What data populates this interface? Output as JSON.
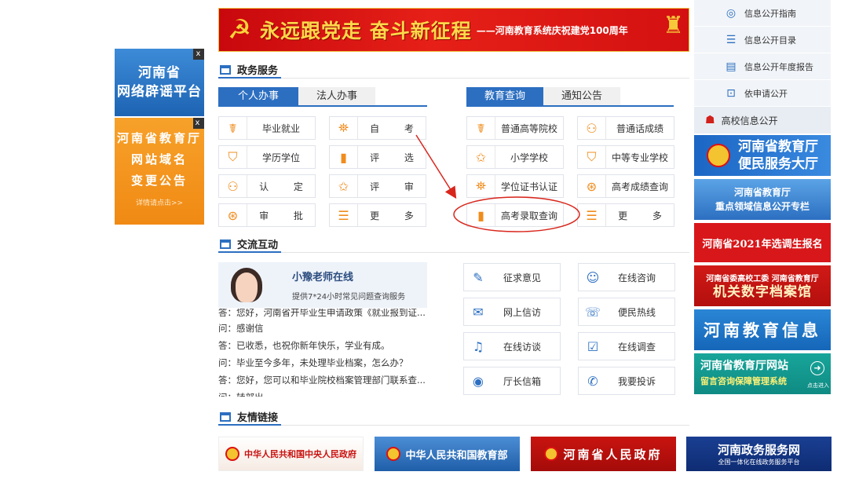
{
  "ads": {
    "rumor": {
      "line1": "河南省",
      "line2": "网络辟谣平台",
      "close": "x"
    },
    "domain": {
      "line1": "河南省教育厅",
      "line2": "网站域名",
      "line3": "变更公告",
      "more": "详情请点击>>",
      "close": "x"
    }
  },
  "banner": {
    "slogan": "永远跟党走 奋斗新征程",
    "sub": "——河南教育系统庆祝建党100周年"
  },
  "gov_service": {
    "title": "政务服务",
    "tabs_left": [
      "个人办事",
      "法人办事"
    ],
    "tabs_right": [
      "教育查询",
      "通知公告"
    ],
    "personal": [
      {
        "label": "毕业就业",
        "icon": "medal-icon",
        "glyph": "☤"
      },
      {
        "label": "自 考",
        "icon": "gift-icon",
        "glyph": "⛯"
      },
      {
        "label": "学历学位",
        "icon": "mortarboard-icon",
        "glyph": "⛉"
      },
      {
        "label": "评 选",
        "icon": "bar-chart-icon",
        "glyph": "▮"
      },
      {
        "label": "认 定",
        "icon": "user-icon",
        "glyph": "⚇"
      },
      {
        "label": "评 审",
        "icon": "star-icon",
        "glyph": "✩"
      },
      {
        "label": "审 批",
        "icon": "seal-icon",
        "glyph": "⊛"
      },
      {
        "label": "更 多",
        "icon": "list-icon",
        "glyph": "☰"
      }
    ],
    "query": [
      {
        "label": "普通高等院校",
        "icon": "medal-icon",
        "glyph": "☤"
      },
      {
        "label": "普通话成绩",
        "icon": "user-icon",
        "glyph": "⚇"
      },
      {
        "label": "小学学校",
        "icon": "star-icon",
        "glyph": "✩"
      },
      {
        "label": "中等专业学校",
        "icon": "mortarboard-icon",
        "glyph": "⛉"
      },
      {
        "label": "学位证书认证",
        "icon": "gift-icon",
        "glyph": "⛯"
      },
      {
        "label": "高考成绩查询",
        "icon": "seal-icon",
        "glyph": "⊛"
      },
      {
        "label": "高考录取查询",
        "icon": "bar-chart-icon",
        "glyph": "▮"
      },
      {
        "label": "更 多",
        "icon": "list-icon",
        "glyph": "☰"
      }
    ]
  },
  "interaction": {
    "title": "交流互动",
    "teacher": {
      "name": "小豫老师在线",
      "desc": "提供7*24小时常见问题查询服务"
    },
    "qa": [
      "答：您好，河南省开毕业生申请政策《就业报到证...",
      "问：感谢信",
      "答：已收悉，也祝你新年快乐，学业有成。",
      "问：毕业至今多年，未处理毕业档案，怎么办？",
      "答：您好，您可以和毕业院校档案管理部门联系查...",
      "问：转部出..."
    ],
    "buttons": [
      {
        "label": "征求意见",
        "icon": "edit-icon",
        "glyph": "✎"
      },
      {
        "label": "在线咨询",
        "icon": "headset-user-icon",
        "glyph": "☺"
      },
      {
        "label": "网上信访",
        "icon": "mail-icon",
        "glyph": "✉"
      },
      {
        "label": "便民热线",
        "icon": "phone-icon",
        "glyph": "☏"
      },
      {
        "label": "在线访谈",
        "icon": "headphones-icon",
        "glyph": "♫"
      },
      {
        "label": "在线调查",
        "icon": "checklist-icon",
        "glyph": "☑"
      },
      {
        "label": "厅长信箱",
        "icon": "weibo-icon",
        "glyph": "◉"
      },
      {
        "label": "我要投诉",
        "icon": "chat-icon",
        "glyph": "✆"
      }
    ]
  },
  "links": {
    "title": "友情链接",
    "items": [
      "中华人民共和国中央人民政府",
      "中华人民共和国教育部",
      "河南省人民政府",
      "河南政务服务网"
    ],
    "item4_sub": "全国一体化在线政务服务平台"
  },
  "sidebar": {
    "items": [
      {
        "label": "信息公开指南",
        "icon": "compass-icon",
        "glyph": "◎"
      },
      {
        "label": "信息公开目录",
        "icon": "list-icon",
        "glyph": "☰"
      },
      {
        "label": "信息公开年度报告",
        "icon": "document-icon",
        "glyph": "▤"
      },
      {
        "label": "依申请公开",
        "icon": "lock-icon",
        "glyph": "⊡"
      }
    ],
    "head": {
      "label": "高校信息公开",
      "icon": "group-icon",
      "glyph": "☗"
    },
    "banners": {
      "service_hall_1": "河南省教育厅",
      "service_hall_2": "便民服务大厅",
      "key_info_1": "河南省教育厅",
      "key_info_2": "重点领域信息公开专栏",
      "selection": "河南省2021年选调生报名",
      "archive_top": "河南省委高校工委 河南省教育厅",
      "archive_big": "机关数字档案馆",
      "edu_info": "河南教育信息",
      "msg_1": "河南省教育厅网站",
      "msg_2": "留言咨询保障管理系统",
      "go": "点击进入"
    }
  },
  "colors": {
    "primary": "#2c6fc1",
    "accent": "#f08c1c",
    "highlight": "#d9261c"
  }
}
